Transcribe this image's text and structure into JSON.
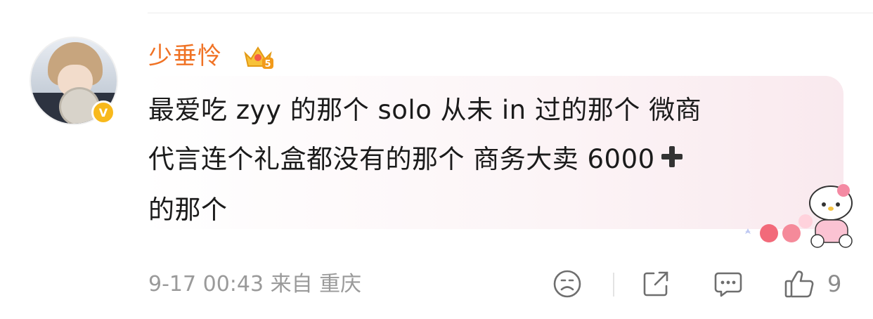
{
  "comment": {
    "username": "少垂怜",
    "vip_level": "5",
    "verified_mark": "V",
    "text_lines": [
      "最爱吃 zyy 的那个 solo 从未 in 过的那个 微商",
      "代言连个礼盒都没有的那个 商务大卖 6000",
      "的那个"
    ],
    "timestamp": "9-17 00:43",
    "location": "来自 重庆",
    "like_count": "9"
  },
  "icons": {
    "avatar": "user-avatar",
    "verified": "verified-v-icon",
    "vip": "crown-vip-icon",
    "plus": "plus-icon",
    "sticker": "hello-kitty-sticker",
    "dislike": "sad-face-icon",
    "share": "share-icon",
    "reply": "comment-icon",
    "like": "thumbs-up-icon"
  },
  "colors": {
    "username": "#f07224",
    "text": "#1b1b1b",
    "meta": "#9a9a9a",
    "verified": "#f8b91c"
  }
}
